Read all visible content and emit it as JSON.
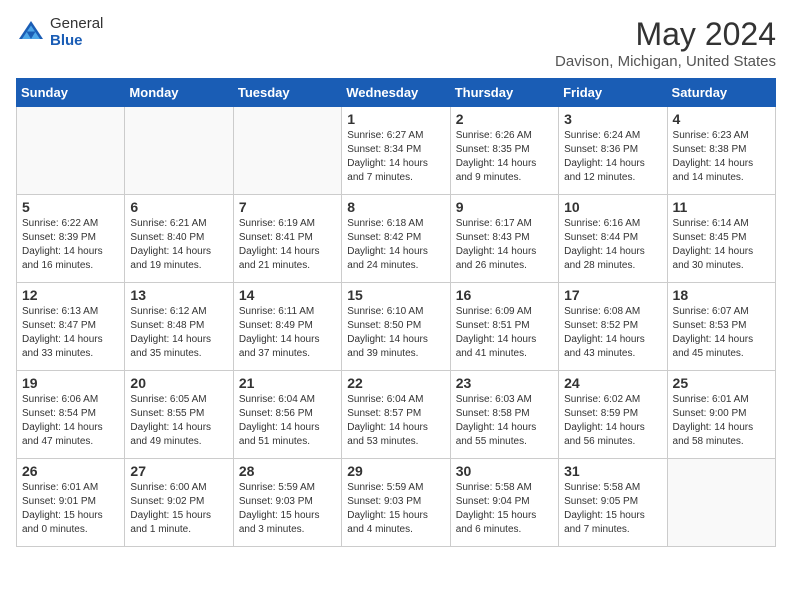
{
  "logo": {
    "general": "General",
    "blue": "Blue"
  },
  "title": "May 2024",
  "location": "Davison, Michigan, United States",
  "headers": [
    "Sunday",
    "Monday",
    "Tuesday",
    "Wednesday",
    "Thursday",
    "Friday",
    "Saturday"
  ],
  "weeks": [
    [
      {
        "day": "",
        "info": ""
      },
      {
        "day": "",
        "info": ""
      },
      {
        "day": "",
        "info": ""
      },
      {
        "day": "1",
        "info": "Sunrise: 6:27 AM\nSunset: 8:34 PM\nDaylight: 14 hours\nand 7 minutes."
      },
      {
        "day": "2",
        "info": "Sunrise: 6:26 AM\nSunset: 8:35 PM\nDaylight: 14 hours\nand 9 minutes."
      },
      {
        "day": "3",
        "info": "Sunrise: 6:24 AM\nSunset: 8:36 PM\nDaylight: 14 hours\nand 12 minutes."
      },
      {
        "day": "4",
        "info": "Sunrise: 6:23 AM\nSunset: 8:38 PM\nDaylight: 14 hours\nand 14 minutes."
      }
    ],
    [
      {
        "day": "5",
        "info": "Sunrise: 6:22 AM\nSunset: 8:39 PM\nDaylight: 14 hours\nand 16 minutes."
      },
      {
        "day": "6",
        "info": "Sunrise: 6:21 AM\nSunset: 8:40 PM\nDaylight: 14 hours\nand 19 minutes."
      },
      {
        "day": "7",
        "info": "Sunrise: 6:19 AM\nSunset: 8:41 PM\nDaylight: 14 hours\nand 21 minutes."
      },
      {
        "day": "8",
        "info": "Sunrise: 6:18 AM\nSunset: 8:42 PM\nDaylight: 14 hours\nand 24 minutes."
      },
      {
        "day": "9",
        "info": "Sunrise: 6:17 AM\nSunset: 8:43 PM\nDaylight: 14 hours\nand 26 minutes."
      },
      {
        "day": "10",
        "info": "Sunrise: 6:16 AM\nSunset: 8:44 PM\nDaylight: 14 hours\nand 28 minutes."
      },
      {
        "day": "11",
        "info": "Sunrise: 6:14 AM\nSunset: 8:45 PM\nDaylight: 14 hours\nand 30 minutes."
      }
    ],
    [
      {
        "day": "12",
        "info": "Sunrise: 6:13 AM\nSunset: 8:47 PM\nDaylight: 14 hours\nand 33 minutes."
      },
      {
        "day": "13",
        "info": "Sunrise: 6:12 AM\nSunset: 8:48 PM\nDaylight: 14 hours\nand 35 minutes."
      },
      {
        "day": "14",
        "info": "Sunrise: 6:11 AM\nSunset: 8:49 PM\nDaylight: 14 hours\nand 37 minutes."
      },
      {
        "day": "15",
        "info": "Sunrise: 6:10 AM\nSunset: 8:50 PM\nDaylight: 14 hours\nand 39 minutes."
      },
      {
        "day": "16",
        "info": "Sunrise: 6:09 AM\nSunset: 8:51 PM\nDaylight: 14 hours\nand 41 minutes."
      },
      {
        "day": "17",
        "info": "Sunrise: 6:08 AM\nSunset: 8:52 PM\nDaylight: 14 hours\nand 43 minutes."
      },
      {
        "day": "18",
        "info": "Sunrise: 6:07 AM\nSunset: 8:53 PM\nDaylight: 14 hours\nand 45 minutes."
      }
    ],
    [
      {
        "day": "19",
        "info": "Sunrise: 6:06 AM\nSunset: 8:54 PM\nDaylight: 14 hours\nand 47 minutes."
      },
      {
        "day": "20",
        "info": "Sunrise: 6:05 AM\nSunset: 8:55 PM\nDaylight: 14 hours\nand 49 minutes."
      },
      {
        "day": "21",
        "info": "Sunrise: 6:04 AM\nSunset: 8:56 PM\nDaylight: 14 hours\nand 51 minutes."
      },
      {
        "day": "22",
        "info": "Sunrise: 6:04 AM\nSunset: 8:57 PM\nDaylight: 14 hours\nand 53 minutes."
      },
      {
        "day": "23",
        "info": "Sunrise: 6:03 AM\nSunset: 8:58 PM\nDaylight: 14 hours\nand 55 minutes."
      },
      {
        "day": "24",
        "info": "Sunrise: 6:02 AM\nSunset: 8:59 PM\nDaylight: 14 hours\nand 56 minutes."
      },
      {
        "day": "25",
        "info": "Sunrise: 6:01 AM\nSunset: 9:00 PM\nDaylight: 14 hours\nand 58 minutes."
      }
    ],
    [
      {
        "day": "26",
        "info": "Sunrise: 6:01 AM\nSunset: 9:01 PM\nDaylight: 15 hours\nand 0 minutes."
      },
      {
        "day": "27",
        "info": "Sunrise: 6:00 AM\nSunset: 9:02 PM\nDaylight: 15 hours\nand 1 minute."
      },
      {
        "day": "28",
        "info": "Sunrise: 5:59 AM\nSunset: 9:03 PM\nDaylight: 15 hours\nand 3 minutes."
      },
      {
        "day": "29",
        "info": "Sunrise: 5:59 AM\nSunset: 9:03 PM\nDaylight: 15 hours\nand 4 minutes."
      },
      {
        "day": "30",
        "info": "Sunrise: 5:58 AM\nSunset: 9:04 PM\nDaylight: 15 hours\nand 6 minutes."
      },
      {
        "day": "31",
        "info": "Sunrise: 5:58 AM\nSunset: 9:05 PM\nDaylight: 15 hours\nand 7 minutes."
      },
      {
        "day": "",
        "info": ""
      }
    ]
  ]
}
